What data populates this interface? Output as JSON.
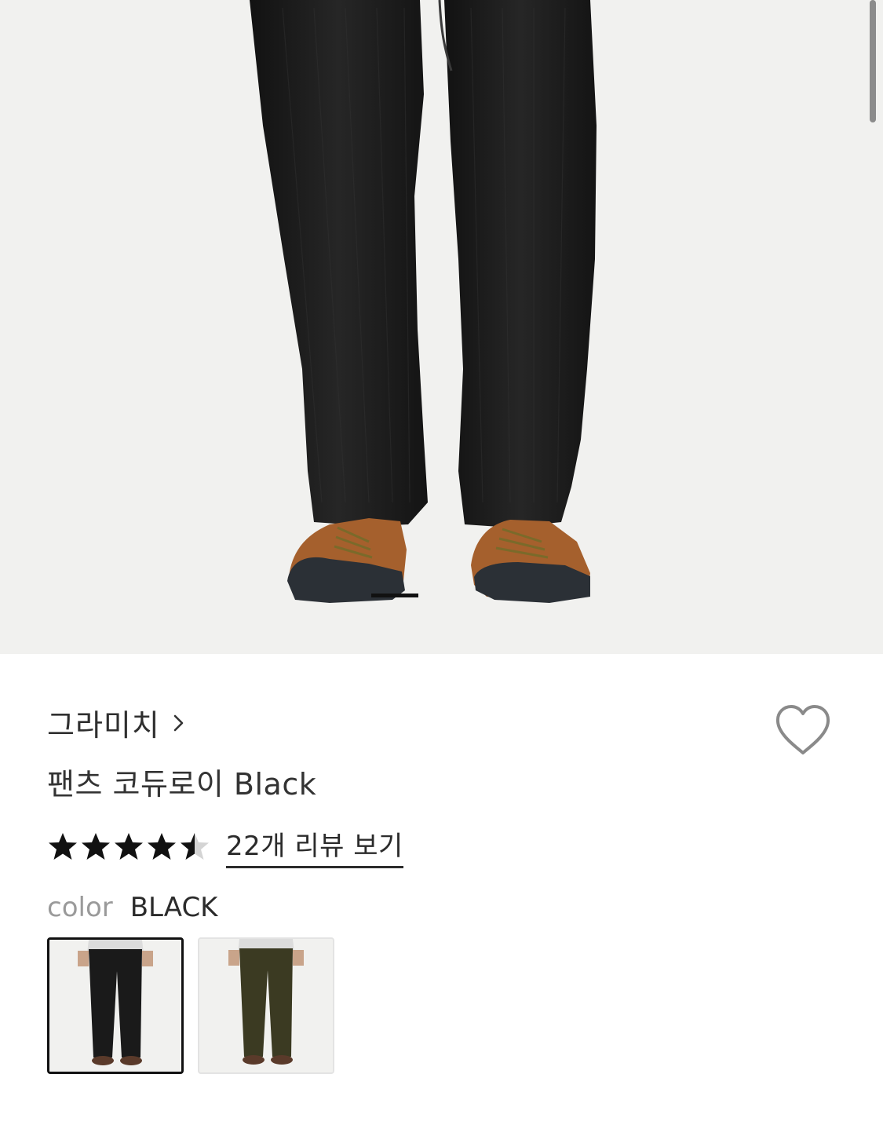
{
  "hero": {
    "image_name": "product-photo-corduroy-pants",
    "pager": {
      "count": 3,
      "active_index": 0
    }
  },
  "product": {
    "brand": "그라미치",
    "title": "팬츠 코듀로이 Black",
    "rating": 4.5,
    "rating_max": 5,
    "review_link": "22개 리뷰 보기",
    "color_label": "color",
    "color_value": "BLACK"
  },
  "swatches": [
    {
      "name": "black",
      "pants_color": "#1a1a1a",
      "selected": true
    },
    {
      "name": "olive",
      "pants_color": "#3b3a22",
      "selected": false
    }
  ],
  "icons": {
    "wishlist": "heart-outline-icon",
    "brand_chevron": "chevron-right-icon",
    "star": "star-icon"
  },
  "colors": {
    "text_primary": "#2f2f2f",
    "text_muted": "#9a9a9a",
    "accent": "#111111",
    "image_bg": "#f1f1ef"
  }
}
